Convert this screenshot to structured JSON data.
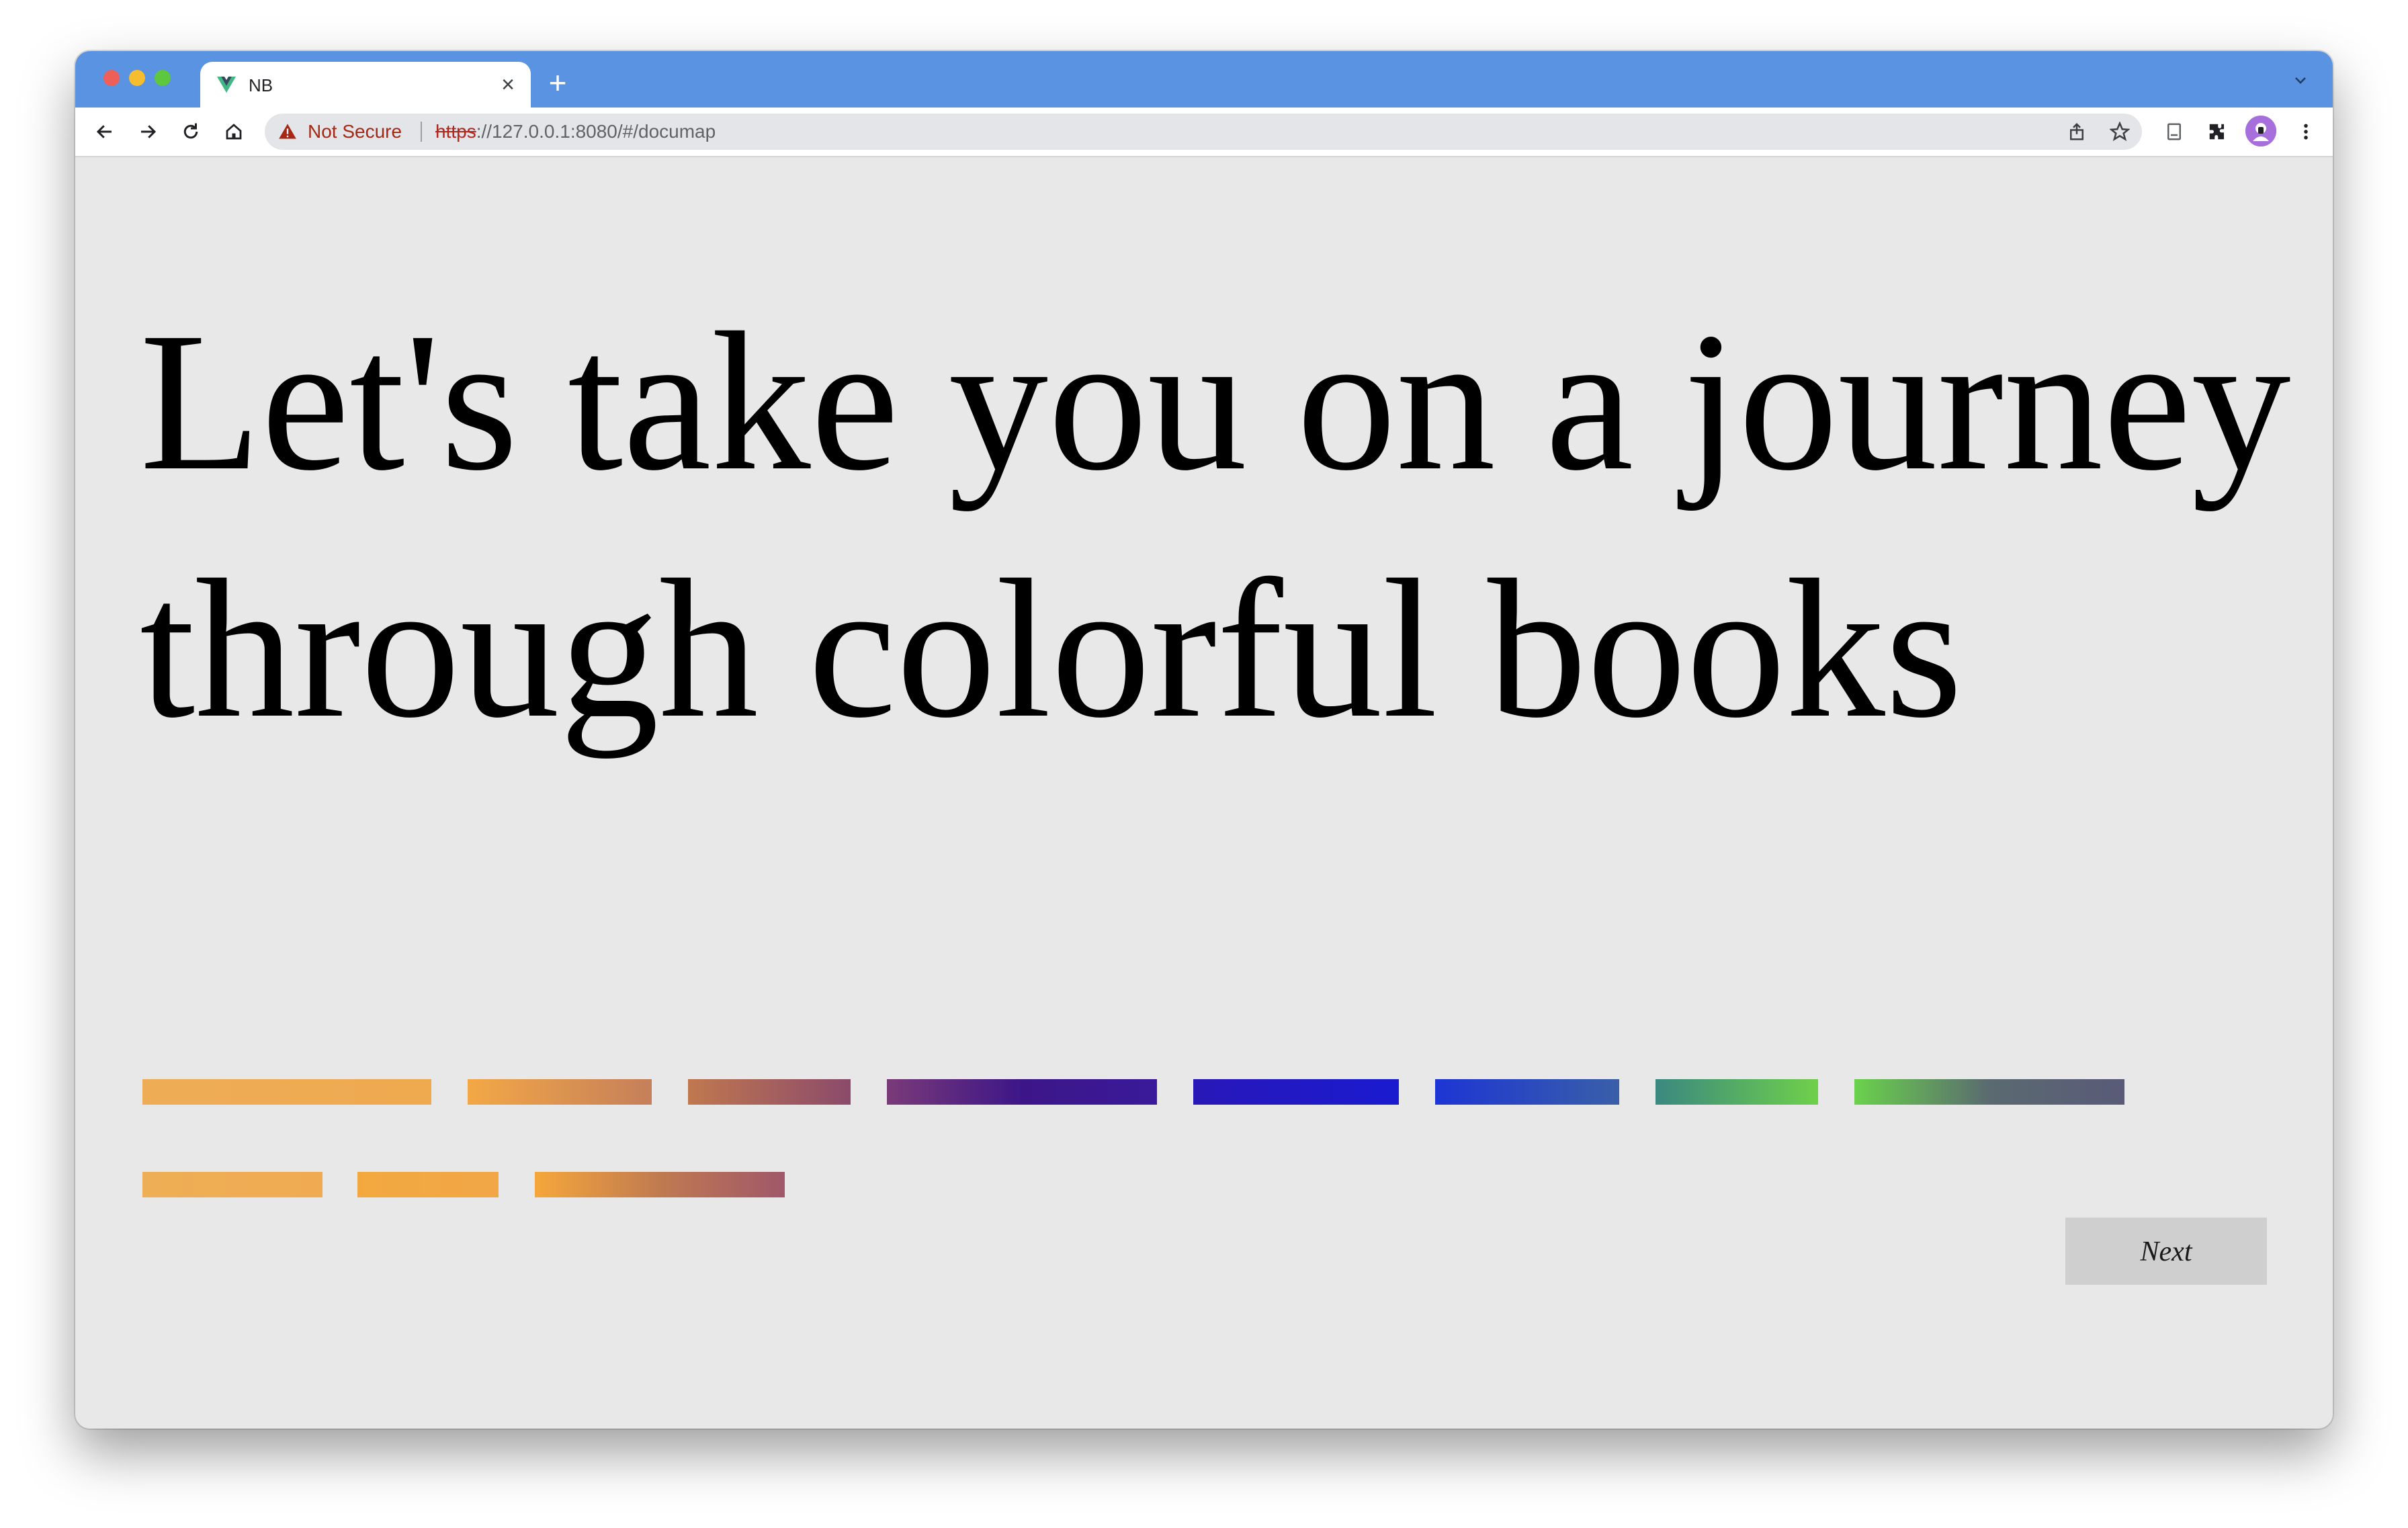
{
  "browser": {
    "tab_title": "NB",
    "tab_close": "×",
    "new_tab": "+",
    "tab_search": "⌄",
    "security_label": "Not Secure",
    "url_scheme": "https",
    "url_rest": "://127.0.0.1:8080/#/documap"
  },
  "page": {
    "headline": "Let's take you on a journey through colorful books",
    "next_label": "Next"
  },
  "progress": {
    "fraction": 1.0
  },
  "colors": {
    "tabstrip": "#5a93e2",
    "page_background": "#e8e8e9",
    "progress_fill": "#ecac55",
    "progress_track": "#cacaca"
  },
  "book_bars": [
    {
      "gradient": [
        "#eeac55",
        "#efaa50"
      ]
    },
    {
      "gradient": [
        "#f3a846",
        "#c57f5a"
      ]
    },
    {
      "gradient": [
        "#c0784f",
        "#8b4a6b"
      ]
    },
    {
      "gradient": [
        "#7a3a78",
        "#3c1688",
        "#3a1a9a"
      ]
    },
    {
      "gradient": [
        "#2818b8",
        "#1a1ad0"
      ]
    },
    {
      "gradient": [
        "#1d35d4",
        "#3a5fa8"
      ]
    },
    {
      "gradient": [
        "#3a8880",
        "#6fd04a"
      ]
    },
    {
      "gradient": [
        "#6ad24c",
        "#5a6a70",
        "#595a78"
      ]
    },
    {
      "gradient": [
        "#eeae55",
        "#f0ab52"
      ]
    },
    {
      "gradient": [
        "#f3a83f",
        "#f1a747"
      ]
    },
    {
      "gradient": [
        "#f5a73b",
        "#c07a50",
        "#a0576a"
      ]
    }
  ]
}
